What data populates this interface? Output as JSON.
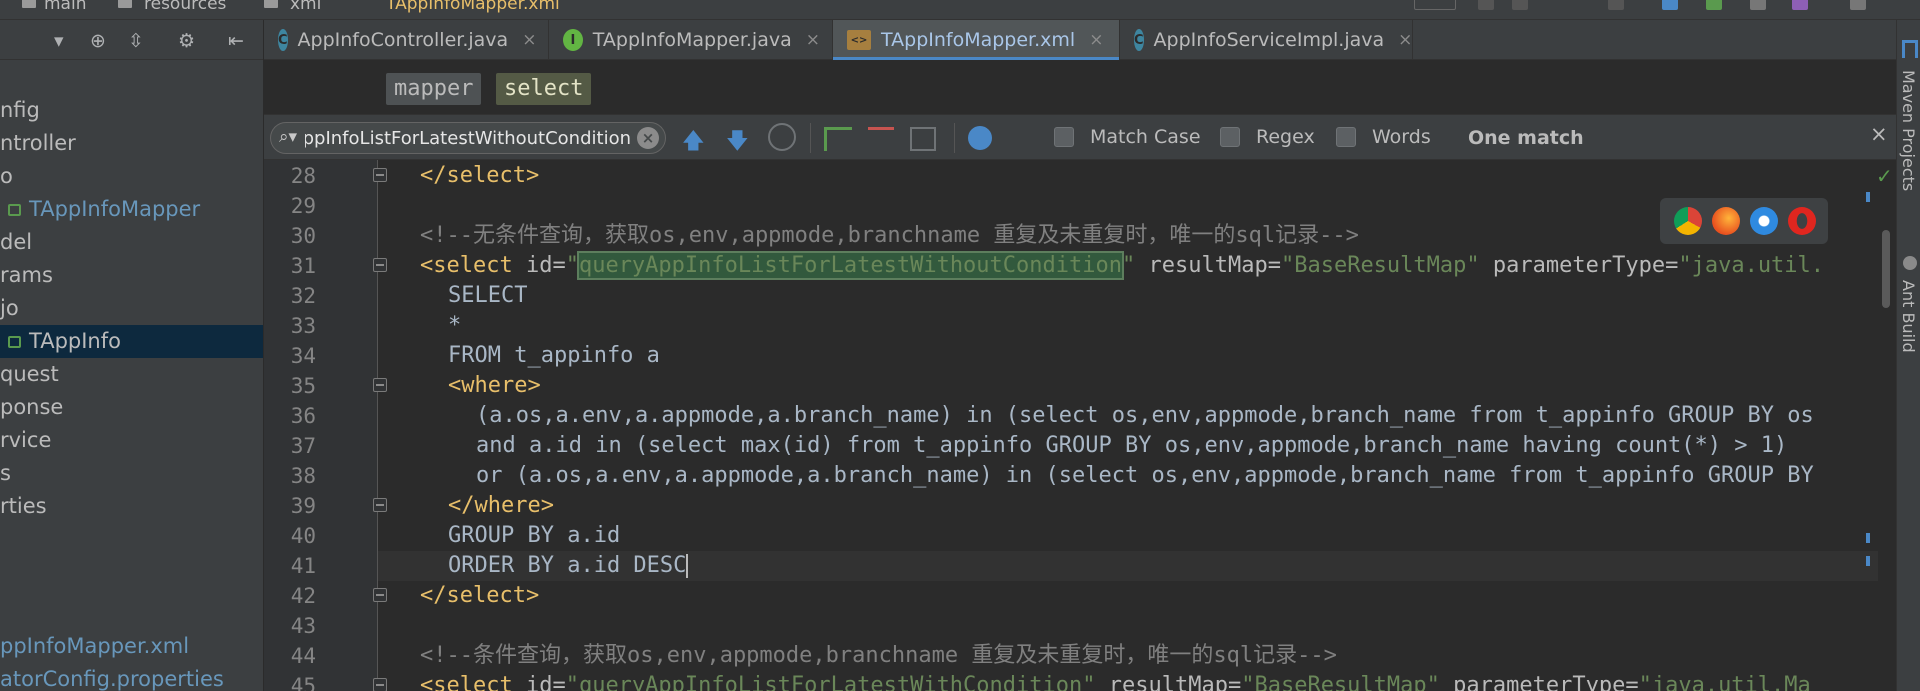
{
  "top_breadcrumbs": [
    "main",
    "resources",
    "xml",
    "TAppInfoMapper.xml"
  ],
  "project_toolbar": {
    "dropdown_glyph": "▾",
    "target_glyph": "⊕",
    "collapse_glyph": "⇳",
    "settings_glyph": "⚙",
    "pin_glyph": "⇤"
  },
  "project_tree": [
    {
      "label": "nfig"
    },
    {
      "label": "ntroller"
    },
    {
      "label": "o"
    },
    {
      "label": "TAppInfoMapper"
    },
    {
      "label": "del"
    },
    {
      "label": "rams"
    },
    {
      "label": "jo"
    },
    {
      "label": "TAppInfo"
    },
    {
      "label": "quest"
    },
    {
      "label": "ponse"
    },
    {
      "label": "rvice"
    },
    {
      "label": "s"
    },
    {
      "label": "rties"
    },
    {
      "label": ""
    },
    {
      "label": "ppInfoMapper.xml"
    },
    {
      "label": "atorConfig.properties"
    }
  ],
  "tabs": [
    {
      "label": "AppInfoController.java",
      "icon": "C"
    },
    {
      "label": "TAppInfoMapper.java",
      "icon": "I"
    },
    {
      "label": "TAppInfoMapper.xml",
      "icon": "<>"
    },
    {
      "label": "AppInfoServiceImpl.java",
      "icon": "C"
    }
  ],
  "tab_close_glyph": "×",
  "xml_breadcrumbs": [
    "mapper",
    "select"
  ],
  "find": {
    "query": "queryAppInfoListForLatestWithoutCondition",
    "search_glyph": "⌕▾",
    "clear_glyph": "×",
    "prev_glyph": "🡅",
    "next_glyph": "🡇",
    "match_case": "Match Case",
    "regex": "Regex",
    "words": "Words",
    "result": "One match",
    "close_glyph": "×"
  },
  "gutter_lines": [
    "28",
    "29",
    "30",
    "31",
    "32",
    "33",
    "34",
    "35",
    "36",
    "37",
    "38",
    "39",
    "40",
    "41",
    "42",
    "43",
    "44",
    "45"
  ],
  "code": {
    "l28": "</select>",
    "l30": "<!--无条件查询，获取os,env,appmode,branchname 重复及未重复时，唯一的sql记录-->",
    "l31_open": "<select",
    "l31_id_attr": " id=",
    "l31_q1": "\"",
    "l31_id_val": "queryAppInfoListForLatestWithoutCondition",
    "l31_q2": "\"",
    "l31_rm_attr": " resultMap=",
    "l31_rm_val": "\"BaseResultMap\"",
    "l31_pt_attr": " parameterType=",
    "l31_pt_val": "\"java.util.",
    "l32": "SELECT",
    "l33": "*",
    "l34": "FROM t_appinfo a",
    "l35": "<where>",
    "l36": "(a.os,a.env,a.appmode,a.branch_name) in (select os,env,appmode,branch_name from t_appinfo GROUP BY os",
    "l37": "and a.id in (select max(id) from t_appinfo GROUP BY os,env,appmode,branch_name having count(*) > 1)",
    "l38": "or (a.os,a.env,a.appmode,a.branch_name) in (select os,env,appmode,branch_name from t_appinfo GROUP BY",
    "l39": "</where>",
    "l40": "GROUP BY a.id",
    "l41": "ORDER BY a.id DESC",
    "l42": "</select>",
    "l44": "<!--条件查询，获取os,env,appmode,branchname 重复及未重复时，唯一的sql记录-->",
    "l45_open": "<select",
    "l45_id_attr": " id=",
    "l45_id_val": "\"queryAppInfoListForLatestWithCondition\"",
    "l45_rm_attr": " resultMap=",
    "l45_rm_val": "\"BaseResultMap\"",
    "l45_pt_attr": " parameterType=",
    "l45_pt_val": "\"java.util.Ma"
  },
  "right_tools": {
    "maven": "Maven Projects",
    "ant": "Ant Build"
  },
  "colors": {
    "editor_bg": "#2b2b2b",
    "panel_bg": "#3c3f41",
    "tag": "#e8bf6a",
    "string": "#6a8759",
    "comment": "#808080",
    "selection": "#0d293e",
    "accent": "#4a88c7"
  }
}
